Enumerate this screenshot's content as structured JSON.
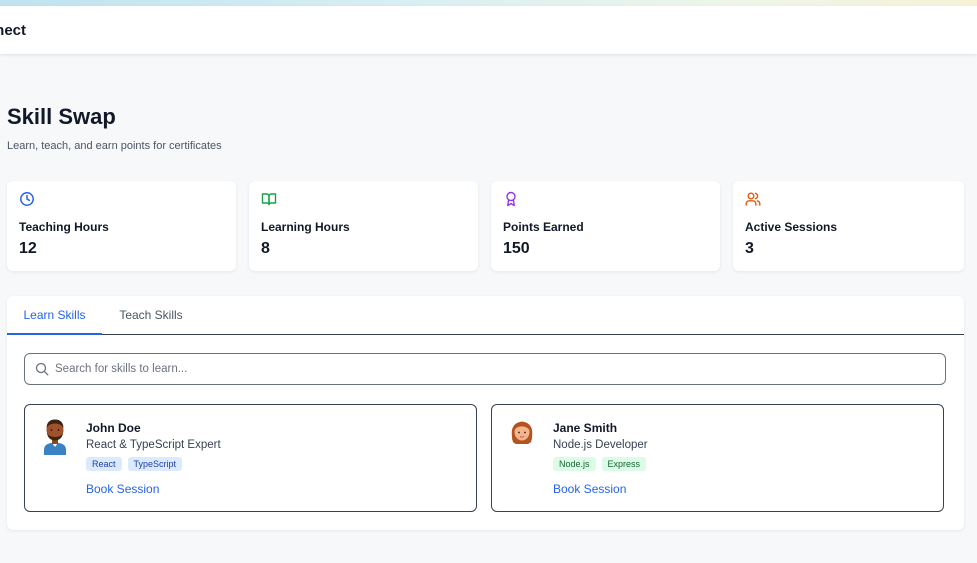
{
  "app": {
    "brand": "nnect"
  },
  "page": {
    "title": "Skill Swap",
    "subtitle": "Learn, teach, and earn points for certificates"
  },
  "stats": [
    {
      "icon": "clock-icon",
      "label": "Teaching Hours",
      "value": "12",
      "color": "#2563eb"
    },
    {
      "icon": "book-open-icon",
      "label": "Learning Hours",
      "value": "8",
      "color": "#16a34a"
    },
    {
      "icon": "award-icon",
      "label": "Points Earned",
      "value": "150",
      "color": "#9333ea"
    },
    {
      "icon": "users-icon",
      "label": "Active Sessions",
      "value": "3",
      "color": "#ea580c"
    }
  ],
  "tabs": [
    {
      "label": "Learn Skills",
      "active": true
    },
    {
      "label": "Teach Skills",
      "active": false
    }
  ],
  "search": {
    "placeholder": "Search for skills to learn...",
    "value": ""
  },
  "mentors": [
    {
      "name": "John Doe",
      "role": "React & TypeScript Expert",
      "tags": [
        "React",
        "TypeScript"
      ],
      "tag_color": "blue",
      "action": "Book Session",
      "avatar": "male-avatar"
    },
    {
      "name": "Jane Smith",
      "role": "Node.js Developer",
      "tags": [
        "Node.js",
        "Express"
      ],
      "tag_color": "green",
      "action": "Book Session",
      "avatar": "female-avatar"
    }
  ],
  "colors": {
    "accent": "#2563eb",
    "border": "#374151"
  }
}
